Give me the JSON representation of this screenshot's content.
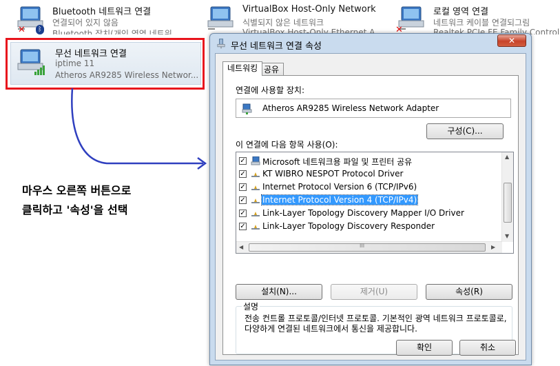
{
  "connections": [
    {
      "title": "Bluetooth 네트워크 연결",
      "status": "연결되어 있지 않음",
      "device": "Bluetooth 장치(개인 영역 네트워"
    },
    {
      "title": "VirtualBox Host-Only Network",
      "status": "식별되지 않은 네트워크",
      "device": "VirtualBox Host-Only Ethernet A"
    },
    {
      "title": "로컬 영역 연결",
      "status": "네트워크 케이블 연결되그림",
      "device": "Realtek PCIe FE Family Controll"
    }
  ],
  "wireless": {
    "title": "무선 네트워크 연결",
    "status": "iptime  11",
    "device": "Atheros AR9285 Wireless Networ..."
  },
  "annotation": {
    "line1": "마우스 오른쪽 버튼으로",
    "line2": "클릭하고 '속성'을 선택"
  },
  "dialog": {
    "title": "무선 네트워크 연결 속성",
    "close": "✕",
    "tabs": {
      "networking": "네트워킹",
      "sharing": "공유"
    },
    "connect_using_label": "연결에 사용할 장치:",
    "adapter": "Atheros AR9285 Wireless Network Adapter",
    "configure_button": "구성(C)...",
    "items_label": "이 연결에 다음 항목 사용(O):",
    "items": [
      {
        "label": "Microsoft 네트워크용 파일 및 프린터 공유",
        "checked": true,
        "icon": "network-client-icon"
      },
      {
        "label": "KT WIBRO NESPOT Protocol Driver",
        "checked": true,
        "icon": "protocol-icon"
      },
      {
        "label": "Internet Protocol Version 6 (TCP/IPv6)",
        "checked": true,
        "icon": "protocol-icon"
      },
      {
        "label": "Internet Protocol Version 4 (TCP/IPv4)",
        "checked": true,
        "icon": "protocol-icon",
        "selected": true
      },
      {
        "label": "Link-Layer Topology Discovery Mapper I/O Driver",
        "checked": true,
        "icon": "protocol-icon"
      },
      {
        "label": "Link-Layer Topology Discovery Responder",
        "checked": true,
        "icon": "protocol-icon"
      }
    ],
    "hscroll_mark": "III",
    "install_button": "설치(N)...",
    "uninstall_button": "제거(U)",
    "properties_button": "속성(R)",
    "description_title": "설명",
    "description_text": "전송 컨트롤 프로토콜/인터넷 프로토콜. 기본적인 광역 네트워크 프로토콜로, 다양하게 연결된 네트워크에서 통신을 제공합니다.",
    "ok_button": "확인",
    "cancel_button": "취소"
  },
  "colors": {
    "highlight": "#e8141c",
    "arrow": "#2f3fbf",
    "selection": "#3399ff"
  }
}
